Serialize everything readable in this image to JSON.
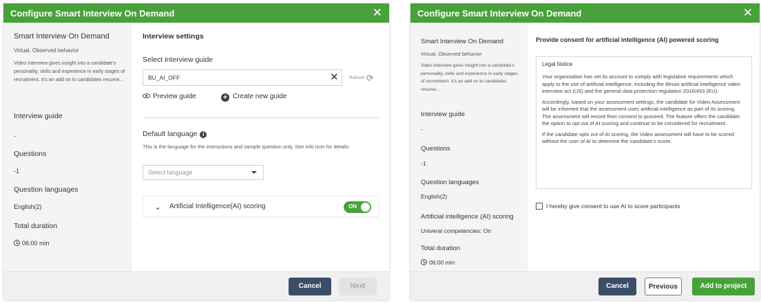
{
  "dialog1": {
    "title": "Configure Smart Interview On Demand",
    "close_symbol": "✕",
    "sidebar": {
      "name": "Smart Interview On Demand",
      "subtitle": "Virtual, Observed behavior",
      "description": "Video Interview gives insight into a candidate's personality, skills and experience in early stages of recruitment. It's an add on to candidates resume...",
      "interview_guide_label": "Interview guide",
      "interview_guide_value": "-",
      "questions_label": "Questions",
      "questions_value": "-1",
      "question_languages_label": "Question languages",
      "question_languages_value": "English(2)",
      "total_duration_label": "Total duration",
      "total_duration_value": "06:00 min"
    },
    "main": {
      "section_title": "Interview settings",
      "guide_label": "Select interview guide",
      "guide_value": "BU_AI_OFF",
      "refresh_label": "Refresh",
      "preview_guide": "Preview guide",
      "create_new_guide": "Create new guide",
      "language_label": "Default language",
      "language_help": "This is the language for the instructions and sample question only. See info icon for details.",
      "language_placeholder": "Select language",
      "ai_scoring_label": "Artificial Intelligence(AI) scoring",
      "ai_toggle_label": "ON"
    },
    "footer": {
      "cancel": "Cancel",
      "next": "Next"
    }
  },
  "dialog2": {
    "title": "Configure Smart Interview On Demand",
    "close_symbol": "✕",
    "sidebar": {
      "name": "Smart Interview On Demand",
      "subtitle": "Virtual, Observed behavior",
      "description": "Video Interview gives insight into a candidate's personality, skills and experience in early stages of recruitment. It's an add on to candidates resume...",
      "interview_guide_label": "Interview guide",
      "interview_guide_value": "-",
      "questions_label": "Questions",
      "questions_value": "-1",
      "question_languages_label": "Question languages",
      "question_languages_value": "English(2)",
      "ai_scoring_label": "Artificial intelligence (AI) scoring",
      "ai_scoring_value": "Univeral competencies: On",
      "total_duration_label": "Total duration",
      "total_duration_value": "06:00 min"
    },
    "main": {
      "consent_title": "Provide consent for artificial intelligence (AI) powered scoring",
      "notice_title": "Legal Notice",
      "notice_p1": "Your organisation has set its account to comply with legislative requirements which apply to the use of artificial intelligence, including the illinois artificial intelligence video interview act (US) and the general data protection regulation 2016/453 (EU).",
      "notice_p2": "Accordingly, based on your assessment settings, the candidate for Video Assessment will be informed that the assessment uses artificial intelligence as part of its scoring. The assessment will record their consent to proceed. The feature offers the candidate the option to opt out of AI scoring and continue to be considered for recruitment.",
      "notice_p3": "If the candidate opts out of AI scoring, the Video assessment will have to be scored without the user of AI to detemine the candidate's score.",
      "consent_checkbox_label": "I hereby give consent to use AI to score participants"
    },
    "footer": {
      "cancel": "Cancel",
      "previous": "Previous",
      "add_to_project": "Add to project"
    }
  },
  "colors": {
    "brand_green": "#48a13a",
    "button_dark": "#3b4e67",
    "sidebar_bg": "#f4f4f4"
  },
  "icons": [
    "close-icon",
    "clock-icon",
    "clear-icon",
    "refresh-icon",
    "eye-icon",
    "plus-circle-icon",
    "info-icon",
    "chevron-down-icon",
    "caret-down-icon",
    "checkbox-icon"
  ]
}
